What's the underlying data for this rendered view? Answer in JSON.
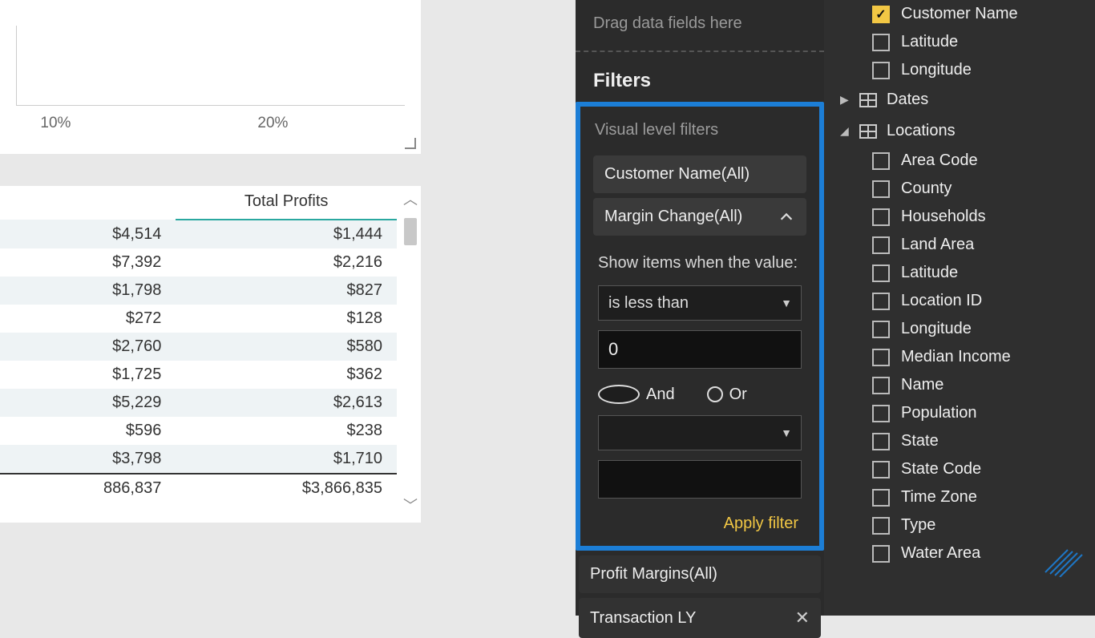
{
  "chart": {
    "ticks": [
      "10%",
      "20%"
    ]
  },
  "table": {
    "header": "Total Profits",
    "rows": [
      {
        "c1": "$4,514",
        "c2": "$1,444"
      },
      {
        "c1": "$7,392",
        "c2": "$2,216"
      },
      {
        "c1": "$1,798",
        "c2": "$827"
      },
      {
        "c1": "$272",
        "c2": "$128"
      },
      {
        "c1": "$2,760",
        "c2": "$580"
      },
      {
        "c1": "$1,725",
        "c2": "$362"
      },
      {
        "c1": "$5,229",
        "c2": "$2,613"
      },
      {
        "c1": "$596",
        "c2": "$238"
      },
      {
        "c1": "$3,798",
        "c2": "$1,710"
      }
    ],
    "total": {
      "c1": "886,837",
      "c2": "$3,866,835"
    }
  },
  "viz": {
    "drop_placeholder": "Drag data fields here",
    "filters_title": "Filters",
    "visual_level_label": "Visual level filters",
    "filter_customer": "Customer Name(All)",
    "filter_margin": "Margin Change(All)",
    "show_items_label": "Show items when the value:",
    "operator_selected": "is less than",
    "value_input": "0",
    "and_label": "And",
    "or_label": "Or",
    "operator2_selected": "",
    "value2_input": "",
    "apply_label": "Apply filter",
    "filter_profit": "Profit Margins(All)",
    "filter_transaction": "Transaction LY"
  },
  "fields": {
    "top": [
      {
        "label": "Customer Name",
        "checked": true
      },
      {
        "label": "Latitude",
        "checked": false
      },
      {
        "label": "Longitude",
        "checked": false
      }
    ],
    "tables": [
      {
        "name": "Dates",
        "expanded": false
      },
      {
        "name": "Locations",
        "expanded": true
      }
    ],
    "locations": [
      "Area Code",
      "County",
      "Households",
      "Land Area",
      "Latitude",
      "Location ID",
      "Longitude",
      "Median Income",
      "Name",
      "Population",
      "State",
      "State Code",
      "Time Zone",
      "Type",
      "Water Area"
    ]
  }
}
